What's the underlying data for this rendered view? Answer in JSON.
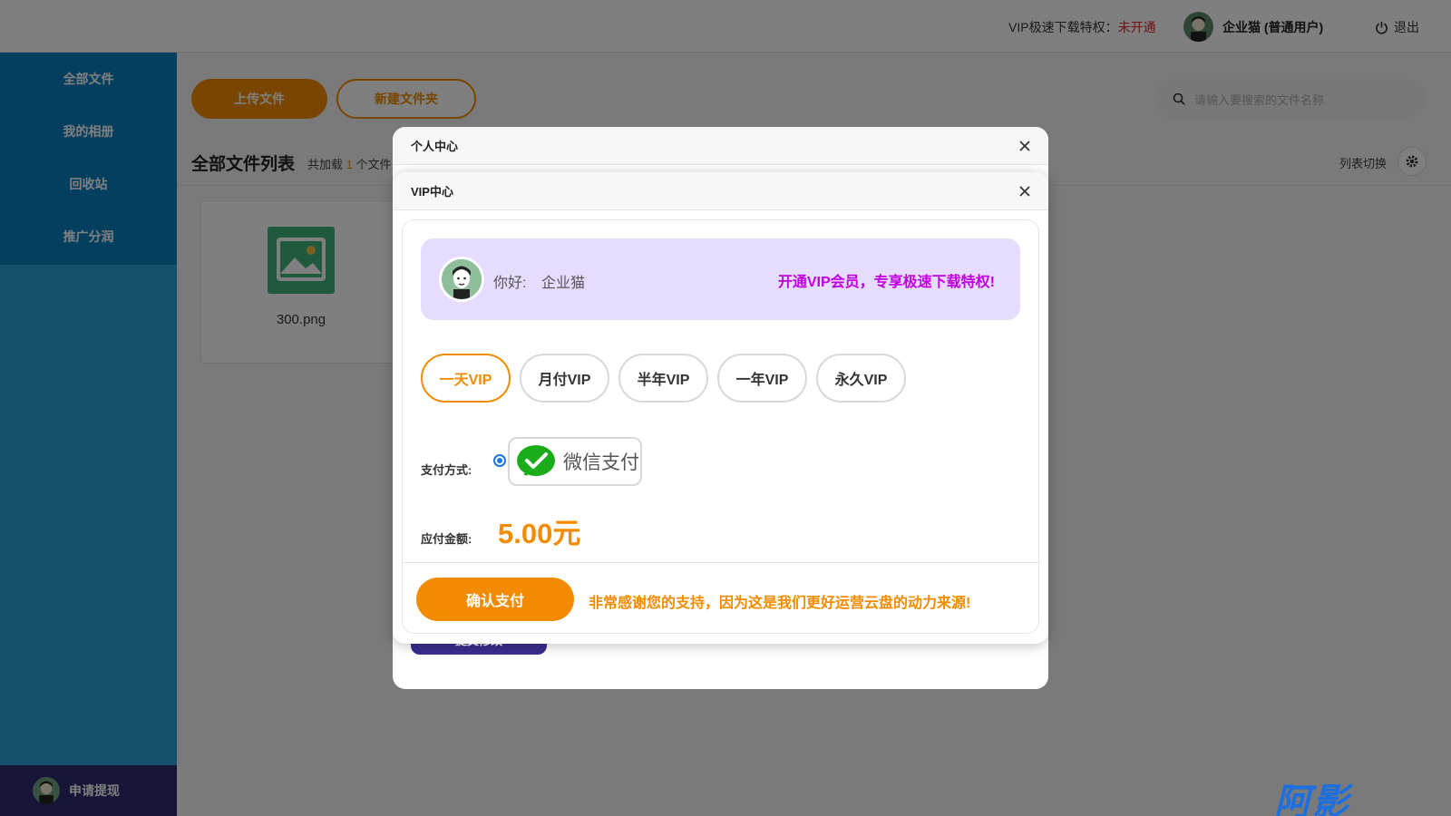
{
  "header": {
    "vip_label": "VIP极速下载特权：",
    "vip_status": "未开通",
    "username": "企业猫 (普通用户)",
    "logout_label": "退出"
  },
  "sidebar": {
    "items": [
      {
        "label": "全部文件"
      },
      {
        "label": "我的相册"
      },
      {
        "label": "回收站"
      },
      {
        "label": "推广分润"
      }
    ],
    "withdraw_label": "申请提现"
  },
  "toolbar": {
    "upload_label": "上传文件",
    "new_folder_label": "新建文件夹",
    "search_placeholder": "请输入要搜索的文件名称"
  },
  "file_list": {
    "title": "全部文件列表",
    "count_prefix": "共加载",
    "count": "1",
    "count_suffix": "个文件",
    "switch_label": "列表切换",
    "files": [
      {
        "name": "300.png"
      }
    ]
  },
  "personal_dialog": {
    "title": "个人中心",
    "submit_label": "提交修改"
  },
  "vip_dialog": {
    "title": "VIP中心",
    "greeting": "你好:",
    "name": "企业猫",
    "promo": "开通VIP会员，专享极速下载特权!",
    "plans": [
      {
        "label": "一天VIP",
        "active": true
      },
      {
        "label": "月付VIP",
        "active": false
      },
      {
        "label": "半年VIP",
        "active": false
      },
      {
        "label": "一年VIP",
        "active": false
      },
      {
        "label": "永久VIP",
        "active": false
      }
    ],
    "pay_method_label": "支付方式:",
    "pay_method": "微信支付",
    "amount_label": "应付金额:",
    "amount": "5.00元",
    "confirm_label": "确认支付",
    "thanks": "非常感谢您的支持，因为这是我们更好运营云盘的动力来源!"
  },
  "colors": {
    "accent": "#f28b00",
    "sidebar": "#2a9fd6",
    "sidebar_menu": "#0b7fbf",
    "promo": "#c000e0",
    "danger": "#e02020"
  },
  "watermark": "阿影"
}
